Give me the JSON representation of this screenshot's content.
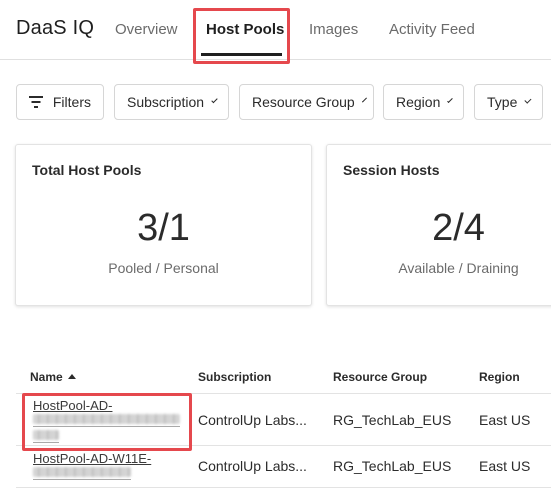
{
  "app": {
    "title": "DaaS IQ"
  },
  "tabs": [
    {
      "label": "Overview",
      "active": false
    },
    {
      "label": "Host Pools",
      "active": true
    },
    {
      "label": "Images",
      "active": false
    },
    {
      "label": "Activity Feed",
      "active": false
    }
  ],
  "filters": {
    "filters_label": "Filters",
    "dropdowns": [
      "Subscription",
      "Resource Group",
      "Region",
      "Type"
    ]
  },
  "cards": [
    {
      "title": "Total Host Pools",
      "value": "3/1",
      "subtitle": "Pooled / Personal"
    },
    {
      "title": "Session Hosts",
      "value": "2/4",
      "subtitle": "Available / Draining"
    }
  ],
  "table": {
    "columns": [
      "Name",
      "Subscription",
      "Resource Group",
      "Region"
    ],
    "sort": {
      "column": "Name",
      "direction": "ascending"
    },
    "rows": [
      {
        "name": "HostPool-AD-",
        "subscription": "ControlUp Labs...",
        "resource_group": "RG_TechLab_EUS",
        "region": "East US"
      },
      {
        "name": "HostPool-AD-W11E-",
        "subscription": "ControlUp Labs...",
        "resource_group": "RG_TechLab_EUS",
        "region": "East US"
      }
    ]
  },
  "colors": {
    "highlight": "#e5484d",
    "text": "#212121",
    "muted": "#6b6b6b",
    "border": "#e0e0e0"
  },
  "icons": {
    "filters": "filter-lines-icon",
    "dropdown": "chevron-down-icon",
    "sort": "sort-ascending-icon"
  }
}
